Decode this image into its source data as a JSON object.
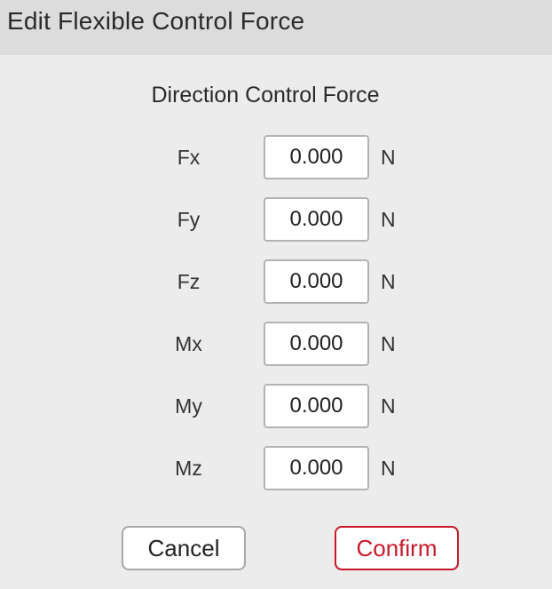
{
  "window": {
    "title": "Edit Flexible Control Force"
  },
  "section": {
    "heading": "Direction Control Force"
  },
  "fields": [
    {
      "label": "Fx",
      "value": "0.000",
      "unit": "N"
    },
    {
      "label": "Fy",
      "value": "0.000",
      "unit": "N"
    },
    {
      "label": "Fz",
      "value": "0.000",
      "unit": "N"
    },
    {
      "label": "Mx",
      "value": "0.000",
      "unit": "N"
    },
    {
      "label": "My",
      "value": "0.000",
      "unit": "N"
    },
    {
      "label": "Mz",
      "value": "0.000",
      "unit": "N"
    }
  ],
  "buttons": {
    "cancel_label": "Cancel",
    "confirm_label": "Confirm"
  },
  "colors": {
    "background": "#ececec",
    "titlebar": "#dcdcdc",
    "accent": "#c8192a",
    "input_border": "#b3b3b3"
  }
}
